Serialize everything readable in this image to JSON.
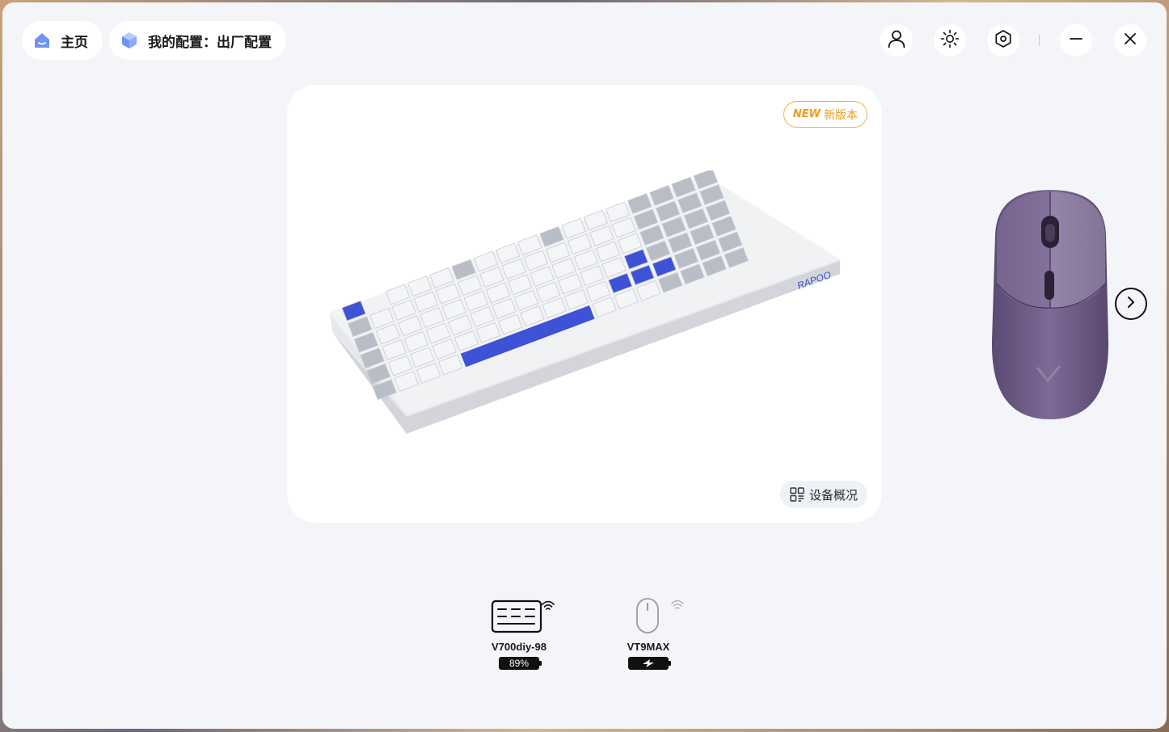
{
  "topbar": {
    "home_label": "主页",
    "config_label": "我的配置：出厂配置"
  },
  "card": {
    "new_badge_tag": "NEW",
    "new_badge_label": "新版本",
    "overview_label": "设备概况",
    "keyboard_brand": "RAPOO"
  },
  "devices": [
    {
      "name": "V700diy-98",
      "battery": "89%",
      "icon": "keyboard-icon"
    },
    {
      "name": "VT9MAX",
      "battery": "",
      "icon": "mouse-icon",
      "charging": true
    }
  ],
  "colors": {
    "accent": "#3b4fd8",
    "badge": "#f09a1a",
    "background": "#f4f5f9"
  }
}
